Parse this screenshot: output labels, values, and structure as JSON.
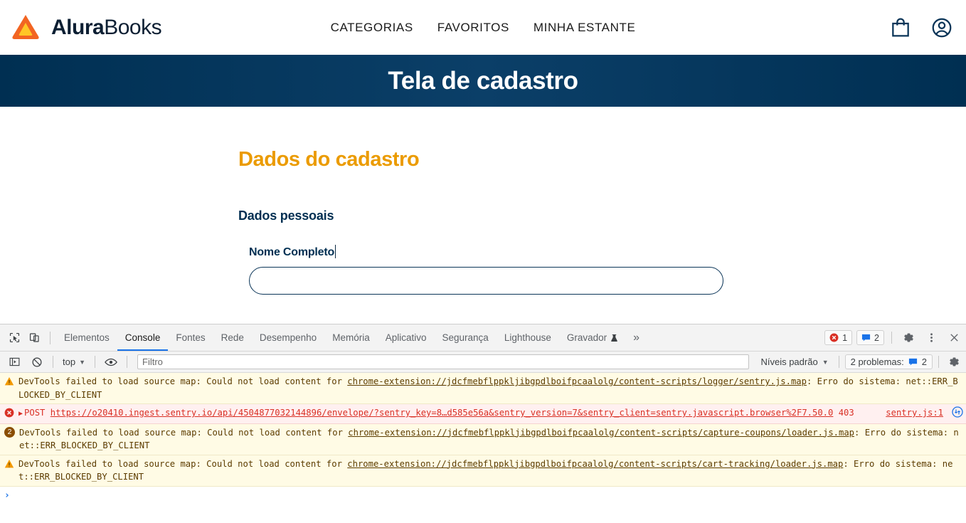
{
  "site": {
    "brand": {
      "strong": "Alura",
      "light": "Books",
      "logo_icon": "triangle-logo-icon"
    },
    "nav": [
      {
        "label": "CATEGORIAS",
        "name": "nav-categorias"
      },
      {
        "label": "FAVORITOS",
        "name": "nav-favoritos"
      },
      {
        "label": "MINHA ESTANTE",
        "name": "nav-minha-estante"
      }
    ],
    "actions": [
      {
        "icon": "shopping-bag-icon"
      },
      {
        "icon": "user-account-icon"
      }
    ],
    "banner_title": "Tela de cadastro",
    "banner_color": "#002F52"
  },
  "form": {
    "title": "Dados do cadastro",
    "title_color": "#EB9B00",
    "section_title": "Dados pessoais",
    "fields": [
      {
        "label": "Nome Completo",
        "value": "",
        "placeholder": ""
      }
    ]
  },
  "devtools": {
    "tabs": [
      {
        "label": "Elementos",
        "active": false
      },
      {
        "label": "Console",
        "active": true
      },
      {
        "label": "Fontes",
        "active": false
      },
      {
        "label": "Rede",
        "active": false
      },
      {
        "label": "Desempenho",
        "active": false
      },
      {
        "label": "Memória",
        "active": false
      },
      {
        "label": "Aplicativo",
        "active": false
      },
      {
        "label": "Segurança",
        "active": false
      },
      {
        "label": "Lighthouse",
        "active": false
      },
      {
        "label": "Gravador",
        "active": false,
        "icon": "beaker-icon"
      }
    ],
    "overflow_label": "»",
    "error_count": "1",
    "info_count": "2",
    "toolbar": {
      "context": "top",
      "filter_placeholder": "Filtro",
      "filter_value": "",
      "levels_label": "Níveis padrão",
      "problems_label": "2 problemas:",
      "problems_count": "2"
    },
    "messages": [
      {
        "type": "warn",
        "icon": "warning-triangle-icon",
        "text_before": "DevTools failed to load source map: Could not load content for ",
        "link": "chrome-extension://jdcfmebflppkljibgpdlboifpcaalolg/content-scripts/logger/sentry.js.map",
        "text_after": ": Erro do sistema: net::ERR_BLOCKED_BY_CLIENT"
      },
      {
        "type": "error",
        "icon": "error-circle-icon",
        "disclosure": "▶",
        "method": "POST",
        "link": "https://o20410.ingest.sentry.io/api/4504877032144896/envelope/?sentry_key=8…d585e56a&sentry_version=7&sentry_client=sentry.javascript.browser%2F7.50.0",
        "status": "403",
        "source": "sentry.js:1",
        "net_icon": "network-request-icon"
      },
      {
        "type": "warn",
        "icon": "count-badge",
        "count": "2",
        "text_before": "DevTools failed to load source map: Could not load content for ",
        "link": "chrome-extension://jdcfmebflppkljibgpdlboifpcaalolg/content-scripts/capture-coupons/loader.js.map",
        "text_after": ": Erro do sistema: net::ERR_BLOCKED_BY_CLIENT"
      },
      {
        "type": "warn",
        "icon": "warning-triangle-icon",
        "text_before": "DevTools failed to load source map: Could not load content for ",
        "link": "chrome-extension://jdcfmebflppkljibgpdlboifpcaalolg/content-scripts/cart-tracking/loader.js.map",
        "text_after": ": Erro do sistema: net::ERR_BLOCKED_BY_CLIENT"
      }
    ],
    "prompt": {
      "chevron": "›",
      "value": ""
    }
  }
}
